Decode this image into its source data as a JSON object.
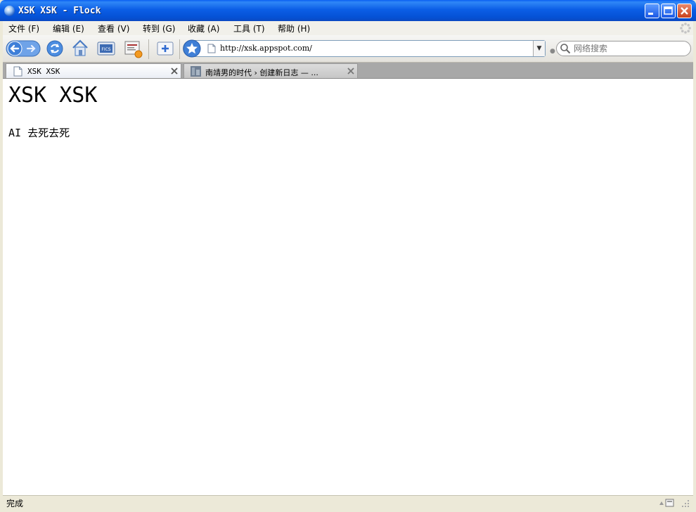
{
  "window": {
    "title": "XSK XSK - Flock"
  },
  "menu": [
    {
      "label": "文件 (F)"
    },
    {
      "label": "编辑 (E)"
    },
    {
      "label": "查看 (V)"
    },
    {
      "label": "转到 (G)"
    },
    {
      "label": "收藏 (A)"
    },
    {
      "label": "工具 (T)"
    },
    {
      "label": "帮助 (H)"
    }
  ],
  "toolbar": {
    "address": "http://xsk.appspot.com/",
    "search_placeholder": "网络搜索"
  },
  "tabs": [
    {
      "label": "XSK XSK"
    },
    {
      "label": "南靖男的时代 › 创建新日志 — ..."
    }
  ],
  "page": {
    "heading": "XSK XSK",
    "body": "AI 去死去死"
  },
  "status": {
    "text": "完成"
  },
  "colors": {
    "titlebar": "#0a5ff2",
    "close_button": "#c9401b"
  }
}
